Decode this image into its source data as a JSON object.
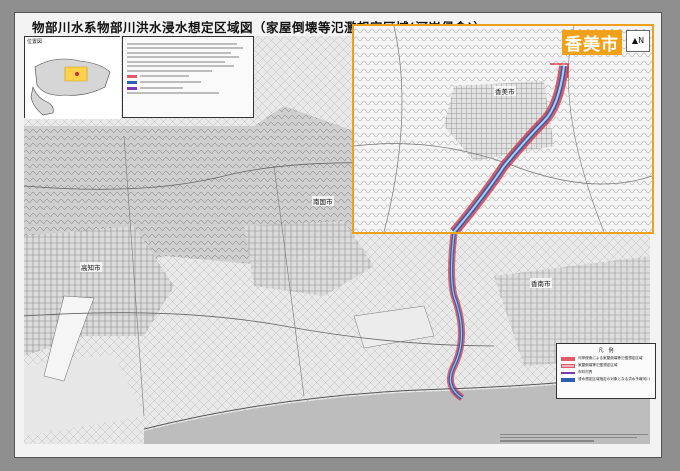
{
  "title": "物部川水系物部川洪水浸水想定区域図（家屋倒壊等氾濫想定区域(河岸侵食)）",
  "inset": {
    "label": "香美市",
    "place": "香美市"
  },
  "places": {
    "nankoku": "南国市",
    "kochi": "高知市",
    "konan": "香南市"
  },
  "overview": {
    "label": "位置図"
  },
  "legend": {
    "title": "凡　例",
    "items": [
      {
        "text": "河岸侵食による家屋倒壊等氾濫想定区域",
        "color": "#e05a6a"
      },
      {
        "text": "家屋倒壊等氾濫想定区域",
        "color": "#f4b0b8"
      },
      {
        "text": "市町村界",
        "color": "#7a3bb0"
      },
      {
        "text": "浸水想定区域指定の対象となる洪水予報河川",
        "color": "#2d5fb0"
      }
    ]
  },
  "colors": {
    "inset_border": "#f0a019",
    "flood_red": "#d2283a",
    "flood_blue": "#2d5fb0"
  }
}
